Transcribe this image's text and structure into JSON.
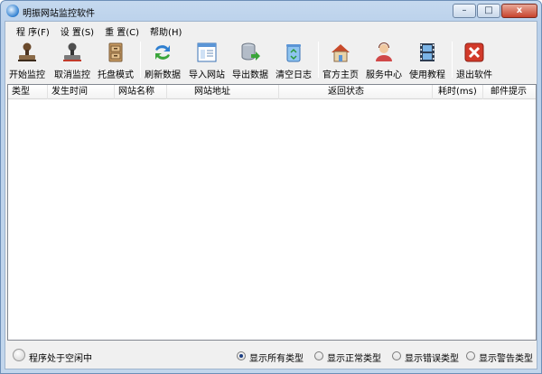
{
  "window": {
    "title": "明振网站监控软件",
    "minimize": "–",
    "maximize": "□",
    "close": "x"
  },
  "menu": [
    {
      "label": "程 序(F)"
    },
    {
      "label": "设 置(S)"
    },
    {
      "label": "重 置(C)"
    },
    {
      "label": "帮助(H)"
    }
  ],
  "toolbar": [
    {
      "label": "开始监控",
      "icon": "stamp-icon"
    },
    {
      "label": "取消监控",
      "icon": "stamp-cancel-icon"
    },
    {
      "label": "托盘模式",
      "icon": "cabinet-icon"
    },
    {
      "label": "刷新数据",
      "icon": "refresh-icon"
    },
    {
      "label": "导入网站",
      "icon": "window-list-icon"
    },
    {
      "label": "导出数据",
      "icon": "database-export-icon"
    },
    {
      "label": "清空日志",
      "icon": "recycle-bin-icon"
    },
    {
      "label": "官方主页",
      "icon": "home-icon"
    },
    {
      "label": "服务中心",
      "icon": "support-person-icon"
    },
    {
      "label": "使用教程",
      "icon": "film-icon"
    },
    {
      "label": "退出软件",
      "icon": "exit-icon"
    }
  ],
  "table": {
    "columns": [
      "类型",
      "发生时间",
      "网站名称",
      "网站地址",
      "返回状态",
      "耗时(ms)",
      "邮件提示"
    ],
    "rows": []
  },
  "status": {
    "state_text": "程序处于空闲中",
    "filters": [
      {
        "label": "显示所有类型",
        "checked": true
      },
      {
        "label": "显示正常类型",
        "checked": false
      },
      {
        "label": "显示错误类型",
        "checked": false
      },
      {
        "label": "显示警告类型",
        "checked": false
      }
    ]
  }
}
